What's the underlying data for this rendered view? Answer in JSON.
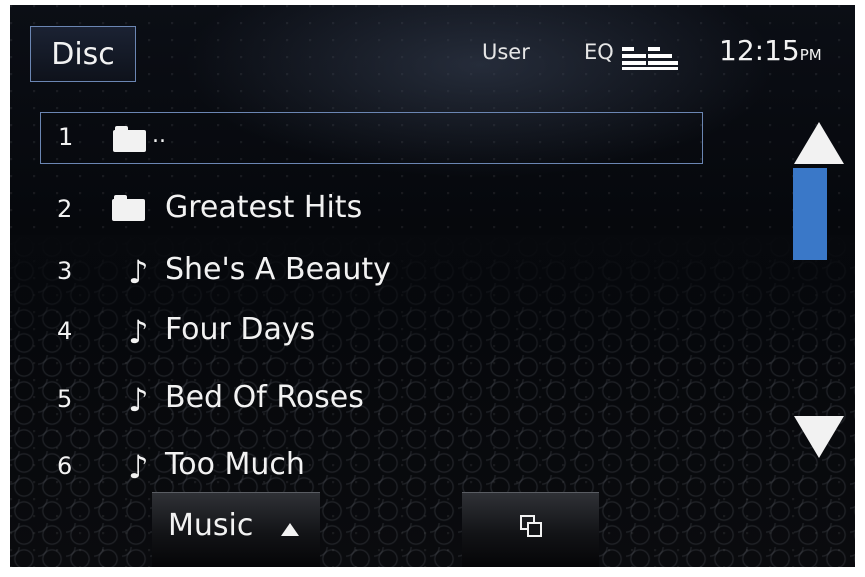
{
  "header": {
    "source_button": "Disc",
    "user_label": "User",
    "eq_label": "EQ",
    "time": "12:15",
    "time_suffix": "PM"
  },
  "list": [
    {
      "number": "1",
      "type": "folder",
      "label": ".."
    },
    {
      "number": "2",
      "type": "folder",
      "label": "Greatest Hits"
    },
    {
      "number": "3",
      "type": "track",
      "note": "♪",
      "label": "She's A Beauty"
    },
    {
      "number": "4",
      "type": "track",
      "note": "♪",
      "label": "Four Days"
    },
    {
      "number": "5",
      "type": "track",
      "note": "♪",
      "label": "Bed Of Roses"
    },
    {
      "number": "6",
      "type": "track",
      "note": "♪",
      "label": "Too Much"
    }
  ],
  "bottom": {
    "music_button": "Music",
    "switch_icon": "window-switch-icon"
  },
  "colors": {
    "accent": "#3a78c8",
    "selection_border": "#6b86b3",
    "text": "#f2f2f2"
  }
}
